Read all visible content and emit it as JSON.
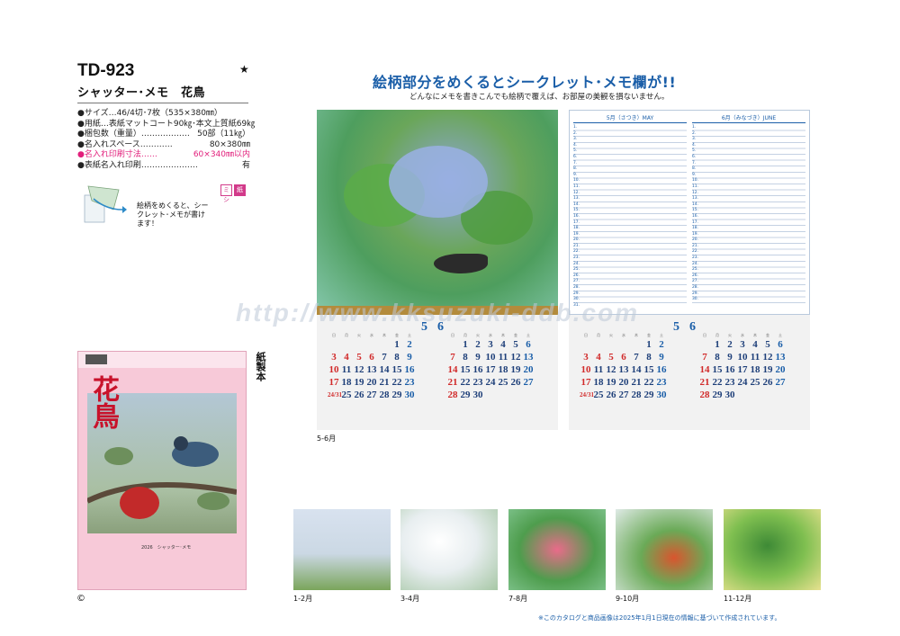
{
  "product": {
    "code": "TD-923",
    "star": "★",
    "name": "シャッター･メモ　花鳥"
  },
  "specs": [
    {
      "label": "●サイズ…46/4切･7枚（535×380㎜）",
      "value": ""
    },
    {
      "label": "●用紙…表紙マットコート90㎏･本文上質紙69㎏",
      "value": ""
    },
    {
      "label": "●梱包数（重量）………………",
      "value": "50部（11㎏）"
    },
    {
      "label": "●名入れスペース…………",
      "value": "80×380㎜"
    },
    {
      "label": "●名入れ印刷寸法……",
      "value": "60×340㎜以内"
    },
    {
      "label": "●表紙名入れ印刷…………………",
      "value": "有"
    }
  ],
  "hint": {
    "text": "絵柄をめくると、シークレット･メモが書けます！",
    "badge_mishi": "ミシ",
    "badge_shi": "紙"
  },
  "cover": {
    "title": "花鳥",
    "year_text": "2026　シャッター･メモ",
    "material": "紙製本"
  },
  "copyright": "©",
  "headline": "絵柄部分をめくるとシークレット･メモ欄が!!",
  "subhead": "どんなにメモを書きこんでも絵柄で覆えば、お部屋の美観を損ないません。",
  "memo": {
    "may_header": "5月（さつき）MAY",
    "june_header": "6月（みなづき）JUNE"
  },
  "calendar": {
    "dow": [
      "日",
      "月",
      "火",
      "水",
      "木",
      "金",
      "土"
    ],
    "may": {
      "number": "5",
      "weeks": [
        [
          "",
          "",
          "",
          "",
          "",
          "1",
          "2"
        ],
        [
          "3",
          "4",
          "5",
          "6",
          "7",
          "8",
          "9"
        ],
        [
          "10",
          "11",
          "12",
          "13",
          "14",
          "15",
          "16"
        ],
        [
          "17",
          "18",
          "19",
          "20",
          "21",
          "22",
          "23"
        ],
        [
          "24/31",
          "25",
          "26",
          "27",
          "28",
          "29",
          "30"
        ]
      ]
    },
    "june": {
      "number": "6",
      "weeks": [
        [
          "",
          "1",
          "2",
          "3",
          "4",
          "5",
          "6"
        ],
        [
          "7",
          "8",
          "9",
          "10",
          "11",
          "12",
          "13"
        ],
        [
          "14",
          "15",
          "16",
          "17",
          "18",
          "19",
          "20"
        ],
        [
          "21",
          "22",
          "23",
          "24",
          "25",
          "26",
          "27"
        ],
        [
          "28",
          "29",
          "30",
          "",
          "",
          "",
          ""
        ]
      ]
    }
  },
  "panel_caption": "5-6月",
  "thumbnails": [
    {
      "caption": "1-2月"
    },
    {
      "caption": "3-4月"
    },
    {
      "caption": "7-8月"
    },
    {
      "caption": "9-10月"
    },
    {
      "caption": "11-12月"
    }
  ],
  "disclaimer": "※このカタログと商品画像は2025年1月1日現在の情報に基づいて作成されています。",
  "watermark": "http://www.kksuzuki-ddb.com",
  "colors": {
    "accent_blue": "#1a5ea8",
    "pink": "#e2207c",
    "sunday_red": "#d12a2a"
  }
}
